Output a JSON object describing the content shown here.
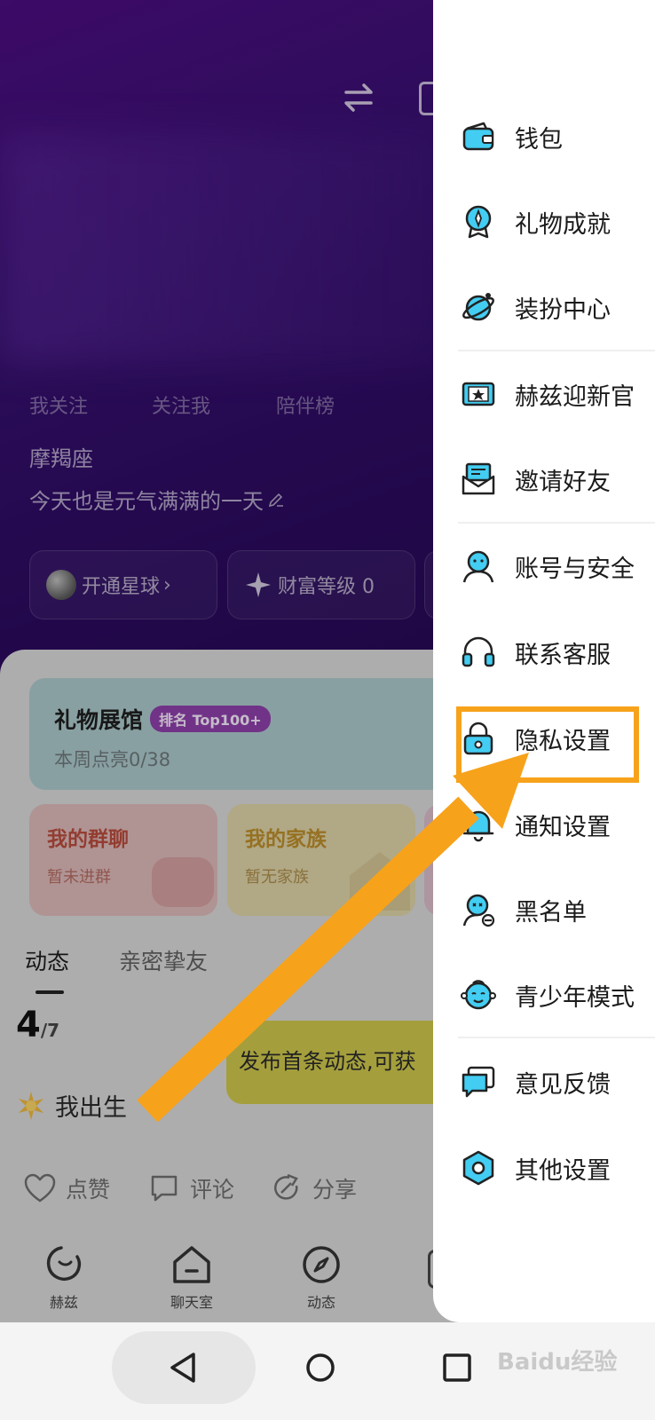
{
  "profile": {
    "tabs": [
      "我关注",
      "关注我",
      "陪伴榜"
    ],
    "constellation": "摩羯座",
    "signature": "今天也是元气满满的一天",
    "pills": {
      "planet": "开通星球",
      "wealth": "财富等级 0"
    }
  },
  "gift_hall": {
    "title": "礼物展馆",
    "badge": "排名 Top100+",
    "subtitle": "本周点亮0/38"
  },
  "cards": {
    "group": {
      "title": "我的群聊",
      "subtitle": "暂未进群"
    },
    "family": {
      "title": "我的家族",
      "subtitle": "暂无家族"
    }
  },
  "feed": {
    "tabs": [
      "动态",
      "亲密挚友"
    ],
    "progress_num": "4",
    "progress_den": "/7",
    "birth_text": "我出生",
    "post_tip": "发布首条动态,可获",
    "actions": {
      "like": "点赞",
      "comment": "评论",
      "share": "分享"
    }
  },
  "bottom_nav": [
    "赫兹",
    "聊天室",
    "动态"
  ],
  "drawer": {
    "items": [
      {
        "label": "钱包",
        "icon": "wallet-icon"
      },
      {
        "label": "礼物成就",
        "icon": "achievement-medal-icon"
      },
      {
        "label": "装扮中心",
        "icon": "dress-up-planet-icon"
      },
      {
        "label": "赫兹迎新官",
        "icon": "ticket-star-icon"
      },
      {
        "label": "邀请好友",
        "icon": "invite-envelope-icon"
      },
      {
        "label": "账号与安全",
        "icon": "account-user-icon"
      },
      {
        "label": "联系客服",
        "icon": "headset-icon"
      },
      {
        "label": "隐私设置",
        "icon": "lock-icon"
      },
      {
        "label": "通知设置",
        "icon": "bell-icon"
      },
      {
        "label": "黑名单",
        "icon": "blocked-user-icon"
      },
      {
        "label": "青少年模式",
        "icon": "child-face-icon"
      },
      {
        "label": "意见反馈",
        "icon": "feedback-chat-icon"
      },
      {
        "label": "其他设置",
        "icon": "settings-hexagon-icon"
      }
    ]
  },
  "watermark": "Baidu经验",
  "colors": {
    "accent_cyan": "#3ec7ef",
    "highlight_orange": "#f7a21b",
    "hero_purple": "#3a0e72"
  }
}
